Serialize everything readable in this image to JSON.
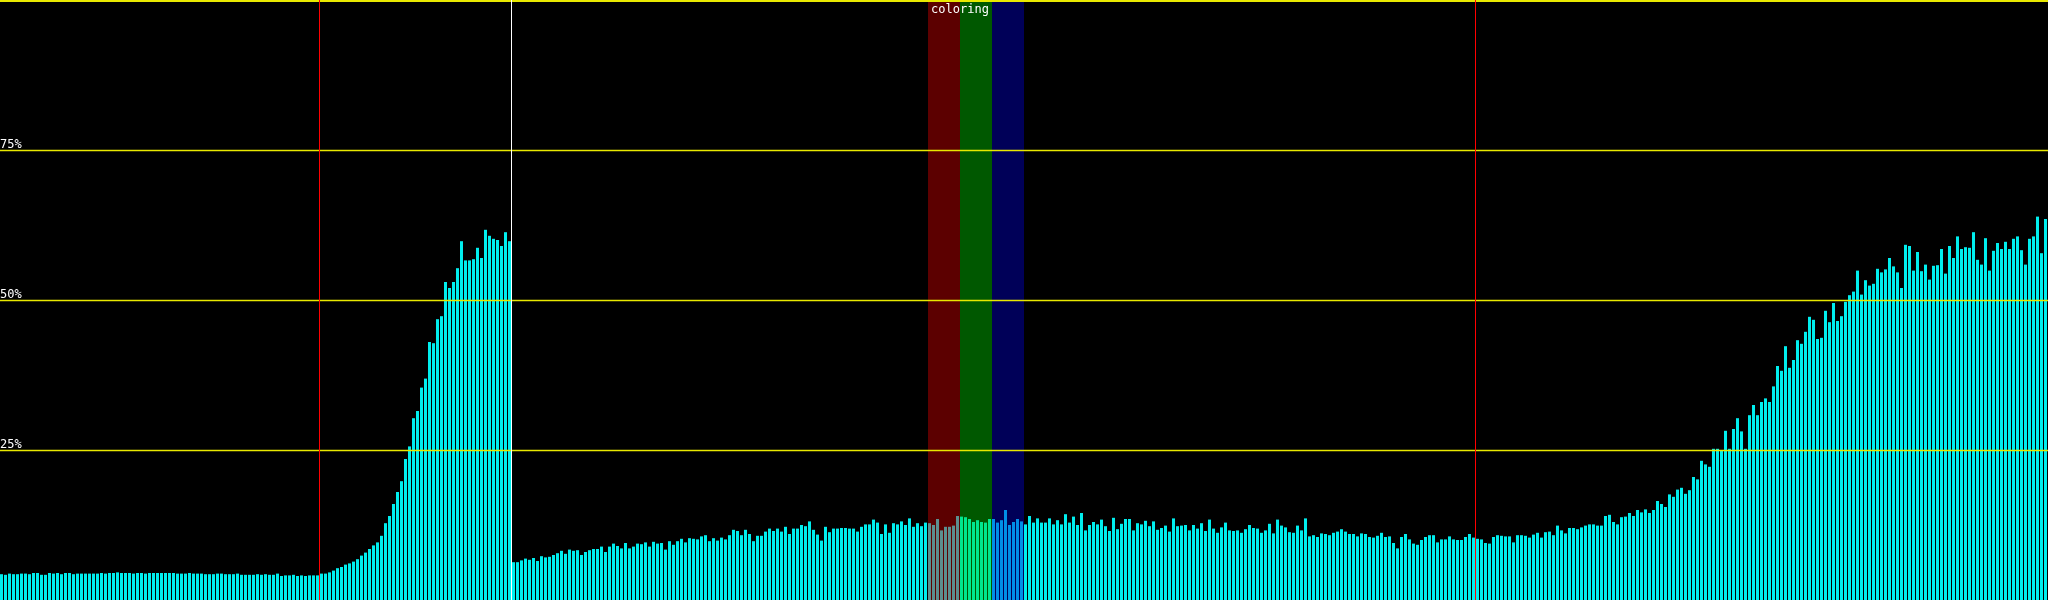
{
  "chart_data": {
    "type": "bar",
    "ylim": [
      0,
      100
    ],
    "yticks": [
      {
        "value": 25,
        "label": "25%"
      },
      {
        "value": 50,
        "label": "50%"
      },
      {
        "value": 75,
        "label": "75%"
      }
    ],
    "values": [
      4.3,
      4.2,
      4.4,
      4.3,
      4.3,
      4.4,
      4.4,
      4.3,
      4.5,
      4.5,
      4.2,
      4.2,
      4.5,
      4.4,
      4.5,
      4.3,
      4.5,
      4.5,
      4.3,
      4.4,
      4.4,
      4.4,
      4.4,
      4.4,
      4.4,
      4.5,
      4.4,
      4.5,
      4.5,
      4.6,
      4.5,
      4.5,
      4.5,
      4.4,
      4.5,
      4.5,
      4.4,
      4.5,
      4.5,
      4.5,
      4.5,
      4.5,
      4.5,
      4.5,
      4.4,
      4.4,
      4.4,
      4.5,
      4.4,
      4.4,
      4.4,
      4.3,
      4.3,
      4.3,
      4.4,
      4.4,
      4.3,
      4.3,
      4.3,
      4.4,
      4.2,
      4.2,
      4.2,
      4.2,
      4.3,
      4.2,
      4.3,
      4.2,
      4.2,
      4.4,
      4.0,
      4.1,
      4.1,
      4.2,
      4.0,
      4.1,
      4.0,
      4.1,
      4.1,
      4.1,
      4.4,
      4.4,
      4.6,
      4.9,
      5.3,
      5.5,
      5.9,
      6.1,
      6.4,
      6.8,
      7.4,
      7.9,
      8.5,
      9.1,
      9.6,
      10.7,
      12.8,
      14,
      16,
      18,
      19.8,
      23.5,
      25.6,
      30.3,
      31.5,
      35.4,
      36.9,
      43,
      42.8,
      46.8,
      47.3,
      53,
      52,
      53,
      55.3,
      59.8,
      56.6,
      56.6,
      56.8,
      58.7,
      57,
      61.7,
      60.7,
      60.2,
      60,
      59,
      61.3,
      59.8,
      6.3,
      6.3,
      6.6,
      6.9,
      6.7,
      7.0,
      6.5,
      7.3,
      7.1,
      7.2,
      7.5,
      7.8,
      8.2,
      7.7,
      8.4,
      8.2,
      8.3,
      7.5,
      8.0,
      8.3,
      8.5,
      8.5,
      8.9,
      8.0,
      8.9,
      9.4,
      9.0,
      8.6,
      9.5,
      8.6,
      8.9,
      9.4,
      9.3,
      9.6,
      8.9,
      9.7,
      9.4,
      9.5,
      8.4,
      9.8,
      9.2,
      9.8,
      10.2,
      9.6,
      10.3,
      10.2,
      10.1,
      10.6,
      10.8,
      9.8,
      10.3,
      9.9,
      10.4,
      10.1,
      10.8,
      11.7,
      11.5,
      10.8,
      11.7,
      11.0,
      9.8,
      10.7,
      10.7,
      11.4,
      11.9,
      11.5,
      11.9,
      11.4,
      12.2,
      11.0,
      11.9,
      11.9,
      12.5,
      12.3,
      13.1,
      11.7,
      10.9,
      9.9,
      12.2,
      11.3,
      11.9,
      11.9,
      12.0,
      12.0,
      11.9,
      11.9,
      11.4,
      12.2,
      12.6,
      12.6,
      13.4,
      12.9,
      11.0,
      12.6,
      11.2,
      12.8,
      12.6,
      13.1,
      12.5,
      13.6,
      12.2,
      12.8,
      12.3,
      12.9,
      12.8,
      12.5,
      13.5,
      11.6,
      12.2,
      12.2,
      12.4,
      14.0,
      13.9,
      13.8,
      13.5,
      13.0,
      13.3,
      13.0,
      12.9,
      13.5,
      13.5,
      12.9,
      13.3,
      15.0,
      12.5,
      13.0,
      13.5,
      13.1,
      12.6,
      14.0,
      12.9,
      13.6,
      12.9,
      12.9,
      13.6,
      12.6,
      13.3,
      12.6,
      14.3,
      12.9,
      13.9,
      12.5,
      14.5,
      11.6,
      12.5,
      13.0,
      12.6,
      13.4,
      12.3,
      11.5,
      13.7,
      11.8,
      12.7,
      13.5,
      13.5,
      11.6,
      12.8,
      12.6,
      13.2,
      12.3,
      13.1,
      11.7,
      12.0,
      12.4,
      11.4,
      13.6,
      12.3,
      12.4,
      12.5,
      11.6,
      12.5,
      11.9,
      12.8,
      11.5,
      13.4,
      11.9,
      11.2,
      12.1,
      12.9,
      11.6,
      11.5,
      11.6,
      11.2,
      11.8,
      12.5,
      12.0,
      11.9,
      11.2,
      11.6,
      12.7,
      11.1,
      13.4,
      12.4,
      12.1,
      11.3,
      11.2,
      12.4,
      11.6,
      13.6,
      10.6,
      10.8,
      10.5,
      11.1,
      11.0,
      10.8,
      11.2,
      11.4,
      11.8,
      11.4,
      11.0,
      11.0,
      10.6,
      11.1,
      11.0,
      10.5,
      10.4,
      10.7,
      11.2,
      10.5,
      10.6,
      9.5,
      8.6,
      10.5,
      11.0,
      10.1,
      9.4,
      9.2,
      10.0,
      10.5,
      10.8,
      10.8,
      9.6,
      10.1,
      10.1,
      10.6,
      10.1,
      10.0,
      10.0,
      10.5,
      11.0,
      10.4,
      10.2,
      10.1,
      9.5,
      9.4,
      10.5,
      10.8,
      10.7,
      10.6,
      10.6,
      9.6,
      10.8,
      10.8,
      10.7,
      10.4,
      10.9,
      11.2,
      10.4,
      11.3,
      11.4,
      10.8,
      12.4,
      11.6,
      11.1,
      12.0,
      12.0,
      11.8,
      12.1,
      12.4,
      12.6,
      12.6,
      12.4,
      12.4,
      14.0,
      14.2,
      13.0,
      12.6,
      13.8,
      13.9,
      14.5,
      14.0,
      15.0,
      14.6,
      15.1,
      14.5,
      15.0,
      16.5,
      16.0,
      15.5,
      17.6,
      17.2,
      18.4,
      18.7,
      17.7,
      18.3,
      20.5,
      20.1,
      23.2,
      22.6,
      22.2,
      25.2,
      25.2,
      24.9,
      28.2,
      25.2,
      28.5,
      30.3,
      28.1,
      25.2,
      30.8,
      32.5,
      30.8,
      33.0,
      33.6,
      33.0,
      35.6,
      39.0,
      38.2,
      42.3,
      38.7,
      40.0,
      43.3,
      42.7,
      44.7,
      47.2,
      46.7,
      43.5,
      43.7,
      48.2,
      46.3,
      49.5,
      46.5,
      47.3,
      49.7,
      50.8,
      51.4,
      54.9,
      50.9,
      53.3,
      52.4,
      52.7,
      55.2,
      54.6,
      55.1,
      57.0,
      55.6,
      54.6,
      52.0,
      59.2,
      59.0,
      54.9,
      58.0,
      54.8,
      55.9,
      53.4,
      55.7,
      55.8,
      58.5,
      54.4,
      59.0,
      57.0,
      60.6,
      58.5,
      58.8,
      58.7,
      61.3,
      56.7,
      55.9,
      60.3,
      54.9,
      58.2,
      59.5,
      58.5,
      59.7,
      58.5,
      60.2,
      60.6,
      58.3,
      55.9,
      60.2,
      60.6,
      63.9,
      57.8,
      63.5
    ],
    "grid": true,
    "annotations": [
      "coloring"
    ]
  },
  "overlay": {
    "stripes": [
      {
        "color": "#5c0000"
      },
      {
        "color": "#005800"
      },
      {
        "color": "#000058"
      }
    ],
    "markers": [
      {
        "color": "#ff0000"
      },
      {
        "color": "#ffffff"
      },
      {
        "color": "#ff0000"
      }
    ]
  }
}
